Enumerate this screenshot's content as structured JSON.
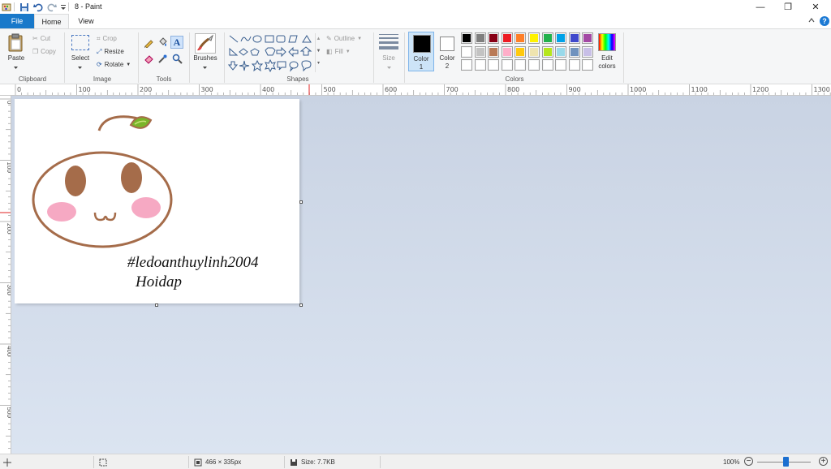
{
  "window": {
    "title": "8 - Paint",
    "minimize": "—",
    "restore": "❐",
    "close": "✕"
  },
  "tabs": {
    "file": "File",
    "home": "Home",
    "view": "View"
  },
  "clipboard": {
    "paste": "Paste",
    "cut": "Cut",
    "copy": "Copy",
    "group": "Clipboard"
  },
  "image": {
    "select": "Select",
    "crop": "Crop",
    "resize": "Resize",
    "rotate": "Rotate",
    "group": "Image"
  },
  "tools": {
    "group": "Tools"
  },
  "brushes": {
    "label": "Brushes"
  },
  "shapes": {
    "outline": "Outline",
    "fill": "Fill",
    "group": "Shapes"
  },
  "size": {
    "label": "Size"
  },
  "colors": {
    "color1": "Color\n1",
    "color1_a": "Color",
    "color1_b": "1",
    "color2_a": "Color",
    "color2_b": "2",
    "edit_a": "Edit",
    "edit_b": "colors",
    "group": "Colors",
    "primary": "#000000",
    "secondary": "#ffffff",
    "palette_row1": [
      "#000000",
      "#7f7f7f",
      "#880015",
      "#ed1c24",
      "#ff7f27",
      "#fff200",
      "#22b14c",
      "#00a2e8",
      "#3f48cc",
      "#a349a4"
    ],
    "palette_row2": [
      "#ffffff",
      "#c3c3c3",
      "#b97a57",
      "#ffaec9",
      "#ffc90e",
      "#efe4b0",
      "#b5e61d",
      "#99d9ea",
      "#7092be",
      "#c8bfe7"
    ],
    "palette_row3": [
      "#ffffff",
      "#ffffff",
      "#ffffff",
      "#ffffff",
      "#ffffff",
      "#ffffff",
      "#ffffff",
      "#ffffff",
      "#ffffff",
      "#ffffff"
    ]
  },
  "ruler": {
    "h_labels": [
      "0",
      "100",
      "200",
      "300",
      "400",
      "500",
      "600",
      "700",
      "800",
      "900",
      "1000",
      "1100",
      "1200",
      "1300"
    ],
    "v_labels": [
      "0",
      "100",
      "200",
      "300",
      "400",
      "500"
    ]
  },
  "canvas_text": {
    "line1": "#ledoanthuylinh2004",
    "line2": "Hoidap"
  },
  "status": {
    "dimensions": "466 × 335px",
    "size": "Size: 7.7KB",
    "zoom": "100%"
  }
}
